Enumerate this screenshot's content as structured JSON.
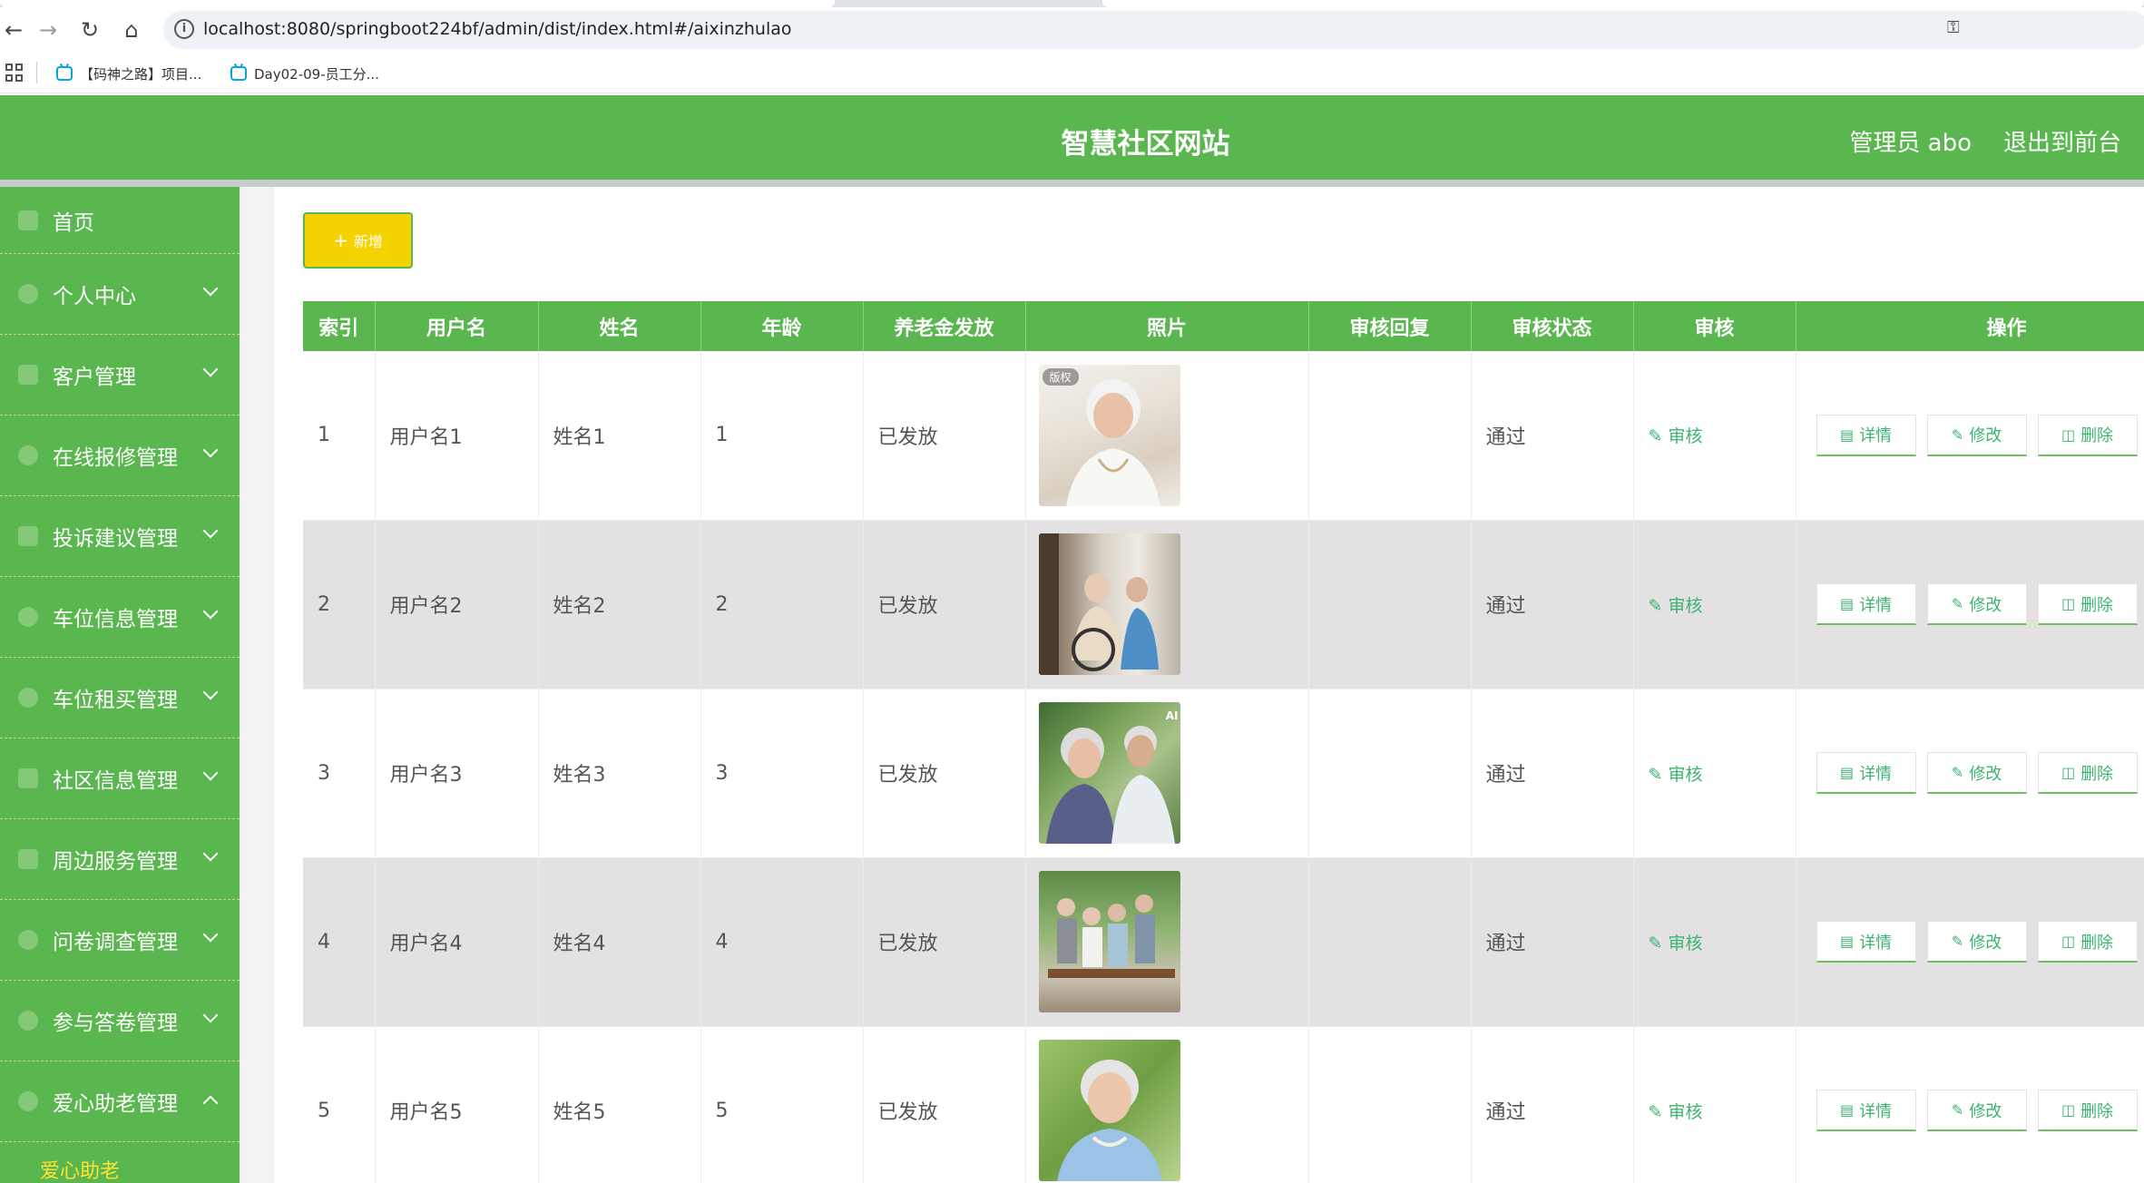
{
  "browser": {
    "url": "localhost:8080/springboot224bf/admin/dist/index.html#/aixinzhulao",
    "bookmarks": [
      "【码神之路】项目...",
      "Day02-09-员工分..."
    ]
  },
  "header": {
    "title": "智慧社区网站",
    "user": "管理员 abo",
    "exit": "退出到前台"
  },
  "sidebar": {
    "items": [
      {
        "label": "首页"
      },
      {
        "label": "个人中心"
      },
      {
        "label": "客户管理"
      },
      {
        "label": "在线报修管理"
      },
      {
        "label": "投诉建议管理"
      },
      {
        "label": "车位信息管理"
      },
      {
        "label": "车位租买管理"
      },
      {
        "label": "社区信息管理"
      },
      {
        "label": "周边服务管理"
      },
      {
        "label": "问卷调查管理"
      },
      {
        "label": "参与答卷管理"
      },
      {
        "label": "爱心助老管理"
      }
    ],
    "sub_item": "爱心助老"
  },
  "toolbar": {
    "add_label": "新增"
  },
  "table": {
    "headers": [
      "索引",
      "用户名",
      "姓名",
      "年龄",
      "养老金发放",
      "照片",
      "审核回复",
      "审核状态",
      "审核",
      "操作"
    ],
    "rows": [
      {
        "index": "1",
        "username": "用户名1",
        "name": "姓名1",
        "age": "1",
        "pension": "已发放",
        "reply": "",
        "status": "通过"
      },
      {
        "index": "2",
        "username": "用户名2",
        "name": "姓名2",
        "age": "2",
        "pension": "已发放",
        "reply": "",
        "status": "通过"
      },
      {
        "index": "3",
        "username": "用户名3",
        "name": "姓名3",
        "age": "3",
        "pension": "已发放",
        "reply": "",
        "status": "通过"
      },
      {
        "index": "4",
        "username": "用户名4",
        "name": "姓名4",
        "age": "4",
        "pension": "已发放",
        "reply": "",
        "status": "通过"
      },
      {
        "index": "5",
        "username": "用户名5",
        "name": "姓名5",
        "age": "5",
        "pension": "已发放",
        "reply": "",
        "status": "通过"
      }
    ],
    "photo_badge": "版权",
    "photo_ai_mark": "AI",
    "audit_label": "审核",
    "detail_label": "详情",
    "edit_label": "修改",
    "delete_label": "删除"
  },
  "colors": {
    "primary": "#5ab64e",
    "add_button": "#f5d300",
    "link": "#3cb371",
    "row_alt": "#e3e1e2"
  }
}
